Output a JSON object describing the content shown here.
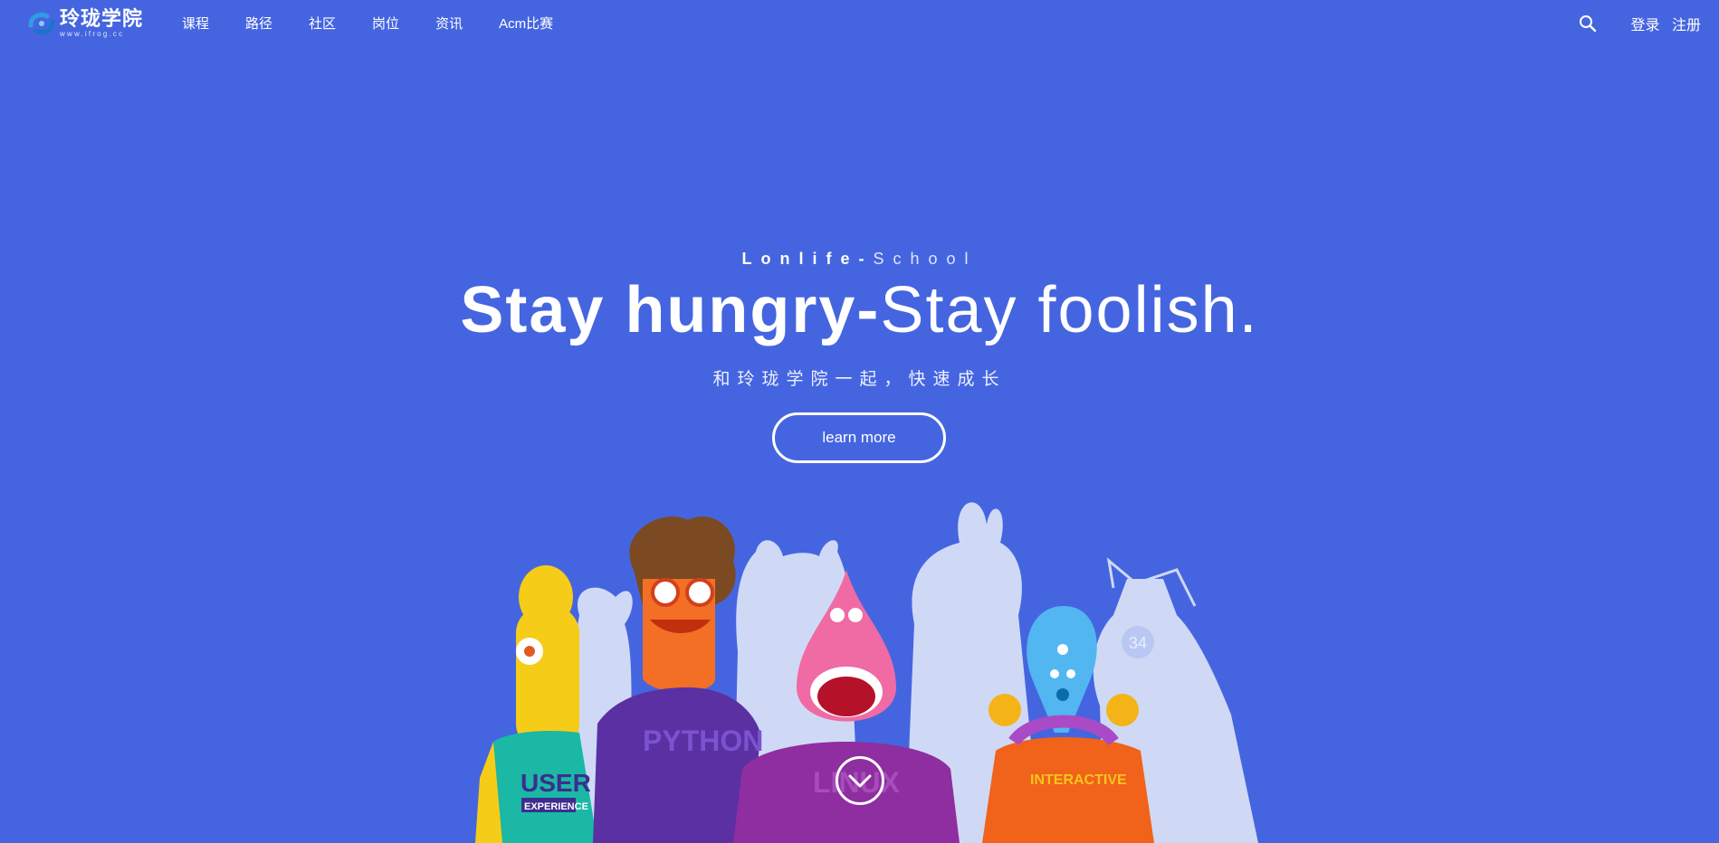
{
  "brand": {
    "name": "玲珑学院",
    "url": "www.ifrog.cc"
  },
  "nav": {
    "items": [
      {
        "label": "课程"
      },
      {
        "label": "路径"
      },
      {
        "label": "社区"
      },
      {
        "label": "岗位"
      },
      {
        "label": "资讯"
      },
      {
        "label": "Acm比赛"
      }
    ]
  },
  "auth": {
    "login": "登录",
    "register": "注册"
  },
  "hero": {
    "kicker_bold": "Lonlife-",
    "kicker_light": "School",
    "headline_bold": "Stay hungry-",
    "headline_light": "Stay foolish.",
    "subtitle": "和玲珑学院一起，快速成长",
    "cta": "learn more"
  },
  "illustration": {
    "shirts": [
      "USER",
      "EXPERIENCE",
      "PYTHON",
      "LINUX",
      "INTERACTIVE"
    ],
    "badge": "34"
  },
  "icons": {
    "logo": "ifrog-logo-icon",
    "search": "search-icon",
    "scroll": "chevron-down-icon"
  },
  "colors": {
    "background": "#4565e0",
    "text": "#ffffff"
  }
}
